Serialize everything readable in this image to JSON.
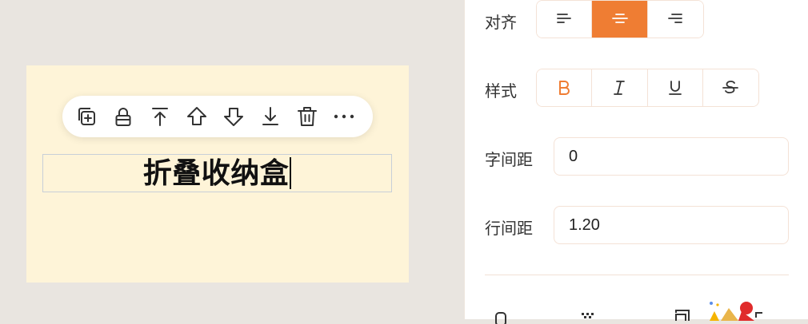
{
  "canvas": {
    "text": "折叠收纳盒",
    "toolbar": {
      "items": [
        {
          "name": "duplicate-icon",
          "tooltip": ""
        },
        {
          "name": "lock-icon",
          "tooltip": ""
        },
        {
          "name": "move-to-top-icon",
          "tooltip": ""
        },
        {
          "name": "move-up-icon",
          "tooltip": ""
        },
        {
          "name": "move-down-icon",
          "tooltip": ""
        },
        {
          "name": "move-to-bottom-icon",
          "tooltip": ""
        },
        {
          "name": "trash-icon",
          "tooltip": ""
        },
        {
          "name": "more-icon",
          "tooltip": ""
        }
      ]
    }
  },
  "panel": {
    "align": {
      "label": "对齐",
      "options": [
        "left-align-icon",
        "center-align-icon",
        "right-align-icon"
      ],
      "selected": "center-align-icon"
    },
    "style": {
      "label": "样式",
      "options": [
        "bold-icon",
        "italic-icon",
        "underline-icon",
        "strikethrough-icon"
      ]
    },
    "letter_spacing": {
      "label": "字间距",
      "value": "0"
    },
    "line_height": {
      "label": "行间距",
      "value": "1.20"
    }
  },
  "colors": {
    "accent": "#ef7d33",
    "artboard": "#fef4d8",
    "canvas_bg": "#e9e5e0"
  }
}
